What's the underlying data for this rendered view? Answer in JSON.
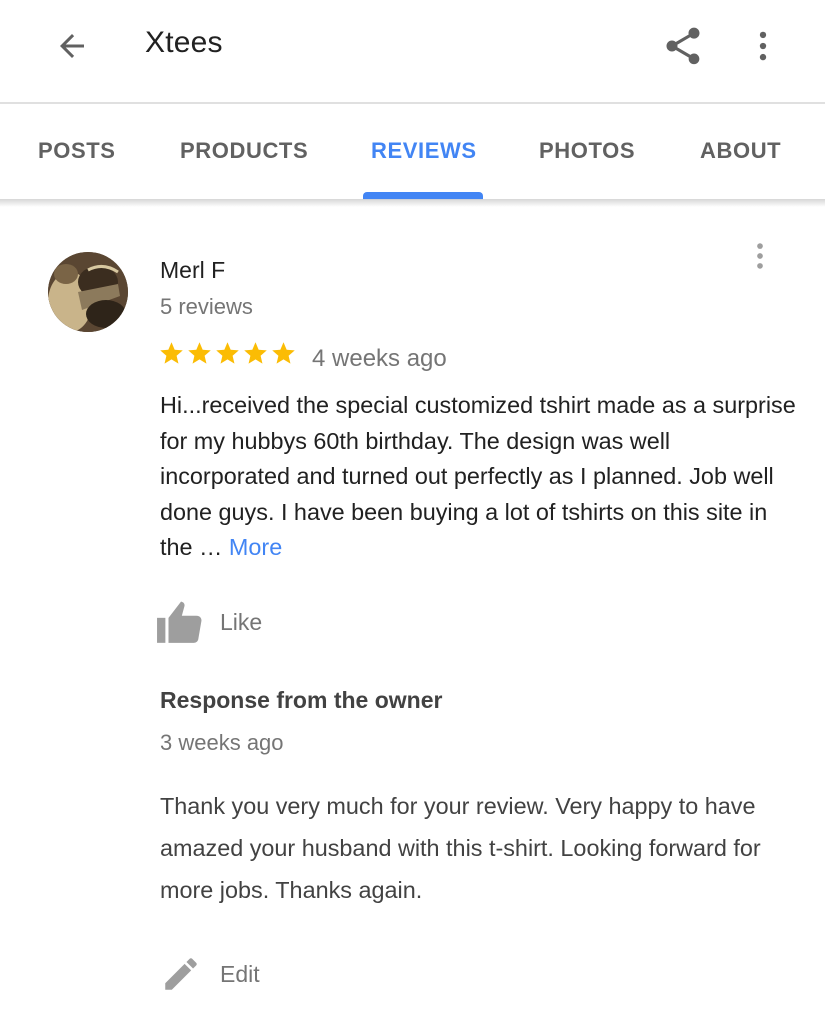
{
  "appbar": {
    "title": "Xtees",
    "back_icon": "arrow-back-icon",
    "share_icon": "share-icon",
    "more_icon": "more-vert-icon"
  },
  "tabs": [
    {
      "label": "POSTS",
      "active": false
    },
    {
      "label": "PRODUCTS",
      "active": false
    },
    {
      "label": "REVIEWS",
      "active": true
    },
    {
      "label": "PHOTOS",
      "active": false
    },
    {
      "label": "ABOUT",
      "active": false
    }
  ],
  "review": {
    "reviewer_name": "Merl F",
    "reviewer_review_count": "5 reviews",
    "rating": 5,
    "rating_max": 5,
    "date": "4 weeks ago",
    "text": "Hi...received the special customized tshirt made as a surprise for my hubbys 60th birthday. The design was well incorporated and turned out perfectly as I planned. Job well done guys. I have been buying a lot of tshirts on this site in the … ",
    "more_label": "More",
    "like_label": "Like"
  },
  "owner_response": {
    "title": "Response from the owner",
    "date": "3 weeks ago",
    "text": "Thank you very much for your review. Very happy to have amazed your husband with this t-shirt. Looking forward for more jobs. Thanks again.",
    "edit_label": "Edit"
  },
  "colors": {
    "accent": "#4285f4",
    "star": "#fbbc04",
    "secondary_text": "#757575",
    "tab_inactive": "#616161"
  }
}
